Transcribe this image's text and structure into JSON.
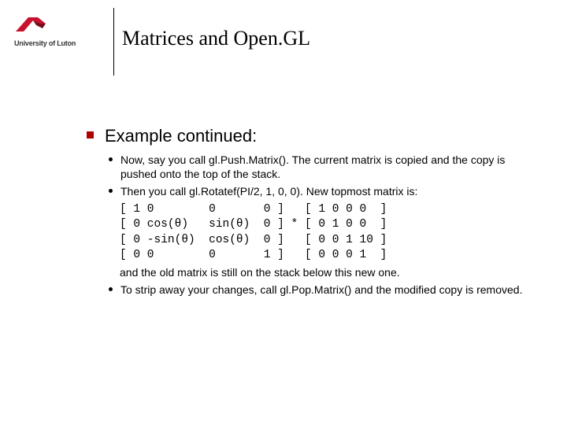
{
  "logo_alt": "University of Luton",
  "title": "Matrices and Open.GL",
  "heading": "Example continued:",
  "bullets": {
    "b1": "Now, say you call gl.Push.Matrix(). The current matrix is copied and the copy is pushed onto the top of the stack.",
    "b2": "Then you call gl.Rotatef(PI/2, 1, 0, 0). New topmost matrix is:",
    "b3_suffix": "and the old matrix is still on the stack below this new one.",
    "b4": "To strip away your changes, call gl.Pop.Matrix() and the modified copy is removed."
  },
  "matrix_rows": {
    "r1": "[ 1 0        0       0 ]   [ 1 0 0 0  ]",
    "r2": "[ 0 cos(θ)   sin(θ)  0 ] * [ 0 1 0 0  ]",
    "r3": "[ 0 -sin(θ)  cos(θ)  0 ]   [ 0 0 1 10 ]",
    "r4": "[ 0 0        0       1 ]   [ 0 0 0 1  ]"
  }
}
